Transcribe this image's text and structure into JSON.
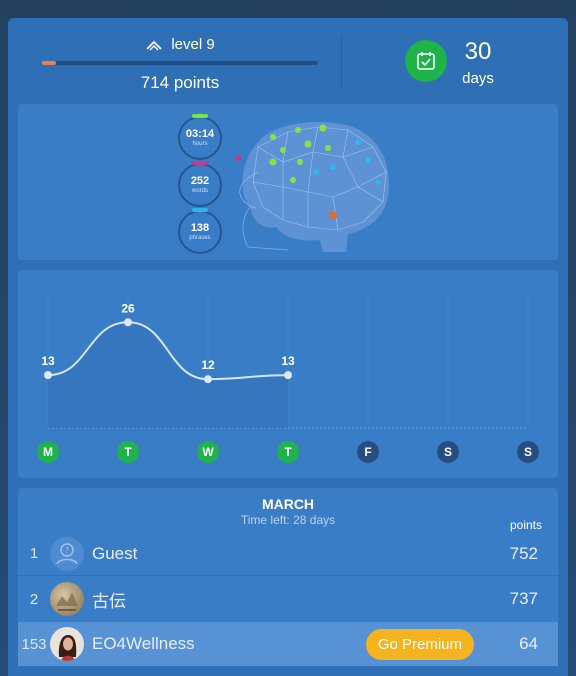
{
  "header": {
    "level_label": "level 9",
    "level_progress": 0.05,
    "points_label": "714 points",
    "streak_number": "30",
    "streak_unit": "days"
  },
  "stats": [
    {
      "value": "03:14",
      "label": "hours",
      "color": "#7be34a"
    },
    {
      "value": "252",
      "label": "words",
      "color": "#c03a8c"
    },
    {
      "value": "138",
      "label": "phrases",
      "color": "#2fb6f0"
    }
  ],
  "chart_data": {
    "type": "line",
    "categories": [
      "M",
      "T",
      "W",
      "T",
      "F",
      "S",
      "S"
    ],
    "values": [
      13,
      26,
      12,
      13,
      null,
      null,
      null
    ],
    "done": [
      true,
      true,
      true,
      true,
      false,
      false,
      false
    ],
    "ylim": [
      0,
      30
    ],
    "title": "",
    "xlabel": "",
    "ylabel": ""
  },
  "leaderboard": {
    "month": "MARCH",
    "time_left": "Time left: 28 days",
    "points_header": "points",
    "rows": [
      {
        "rank": "1",
        "name": "Guest",
        "points": "752"
      },
      {
        "rank": "2",
        "name": "古伝",
        "points": "737"
      },
      {
        "rank": "153",
        "name": "EO4Wellness",
        "points": "64"
      }
    ],
    "premium_label": "Go Premium"
  },
  "colors": {
    "panel": "#2f6fb5",
    "card": "#3a7dc7",
    "green": "#1eb44a",
    "day_inactive": "#264f80",
    "premium": "#f5b320",
    "xp": "#ef7a5a"
  },
  "icons": {
    "level": "chevron-up-icon",
    "streak": "calendar-check-icon",
    "guest_avatar": "user-question-icon"
  }
}
